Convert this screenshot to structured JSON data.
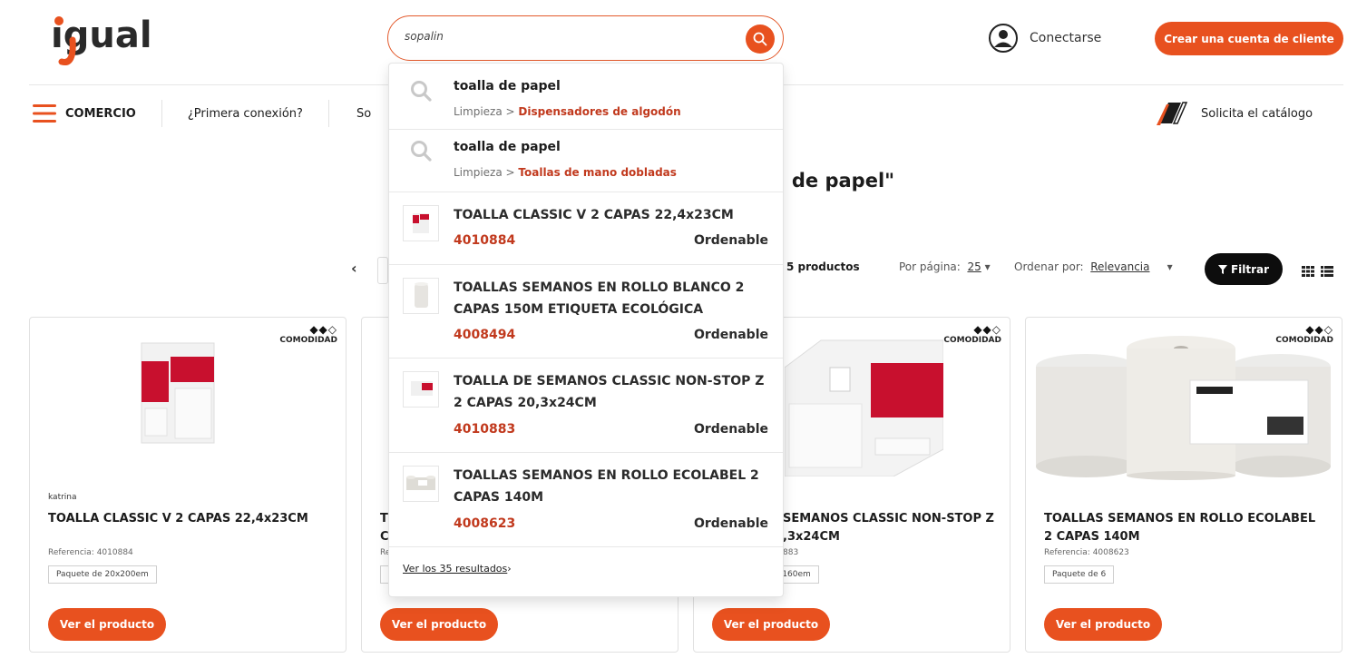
{
  "header": {
    "logo_text": "igual",
    "search_value": "sopalin",
    "login_label": "Conectarse",
    "create_account_label": "Crear una cuenta de cliente"
  },
  "nav": {
    "menu_label": "COMERCIO",
    "first_connection": "¿Primera conexión?",
    "partial_item": "So",
    "catalog_label": "Solicita el catálogo"
  },
  "results": {
    "title_visible": "lla de papel\"",
    "count_label": "5 productos",
    "per_page_label": "Por página:",
    "per_page_value": "25",
    "sort_label": "Ordenar por:",
    "sort_value": "Relevancia",
    "filter_label": "Filtrar"
  },
  "cards": [
    {
      "badge": "COMODIDAD",
      "rating": "◆◆◇",
      "brand": "katrina",
      "title": "TOALLA CLASSIC V 2 CAPAS 22,4x23CM",
      "reference": "Referencia: 4010884",
      "pack": "Paquete de 20x200em",
      "button": "Ver el producto"
    },
    {
      "title_line1_start": "T",
      "title_line2_start": "C",
      "ref_start": "Re",
      "button": "Ver el producto"
    },
    {
      "badge": "COMODIDAD",
      "rating": "◆◆◇",
      "title_line1": "SEMANOS CLASSIC NON-STOP Z",
      "title_line2": ",3x24CM",
      "reference": "883",
      "pack": "x160em",
      "button": "Ver el producto"
    },
    {
      "badge": "COMODIDAD",
      "rating": "◆◆◇",
      "title": "TOALLAS SEMANOS EN ROLLO ECOLABEL 2 CAPAS 140M",
      "reference": "Referencia: 4008623",
      "pack": "Paquete de 6",
      "button": "Ver el producto"
    }
  ],
  "dropdown": {
    "suggestions": [
      {
        "term": "toalla de papel",
        "parent": "Limpieza",
        "sep": " > ",
        "category": "Dispensadores de algodón"
      },
      {
        "term": "toalla de papel",
        "parent": "Limpieza",
        "sep": " > ",
        "category": "Toallas de mano dobladas"
      }
    ],
    "products": [
      {
        "name": "TOALLA CLASSIC V 2 CAPAS 22,4x23CM",
        "ref": "4010884",
        "status": "Ordenable"
      },
      {
        "name": "TOALLAS SEMANOS EN ROLLO BLANCO 2 CAPAS 150M ETIQUETA ECOLÓGICA",
        "ref": "4008494",
        "status": "Ordenable"
      },
      {
        "name": "TOALLA DE SEMANOS CLASSIC NON-STOP Z 2 CAPAS 20,3x24CM",
        "ref": "4010883",
        "status": "Ordenable"
      },
      {
        "name": "TOALLAS SEMANOS EN ROLLO ECOLABEL 2 CAPAS 140M",
        "ref": "4008623",
        "status": "Ordenable"
      }
    ],
    "see_all": "Ver los 35 resultados",
    "see_all_chevron": "›"
  },
  "colors": {
    "brand_orange": "#e8511f",
    "accent_red": "#c1391d",
    "dark": "#0d0d0d"
  },
  "icons": [
    "search-icon",
    "user-icon",
    "menu-icon",
    "catalog-icon",
    "chevron-left-icon",
    "caret-down-icon",
    "filter-icon",
    "grid-view-icon",
    "list-view-icon"
  ]
}
